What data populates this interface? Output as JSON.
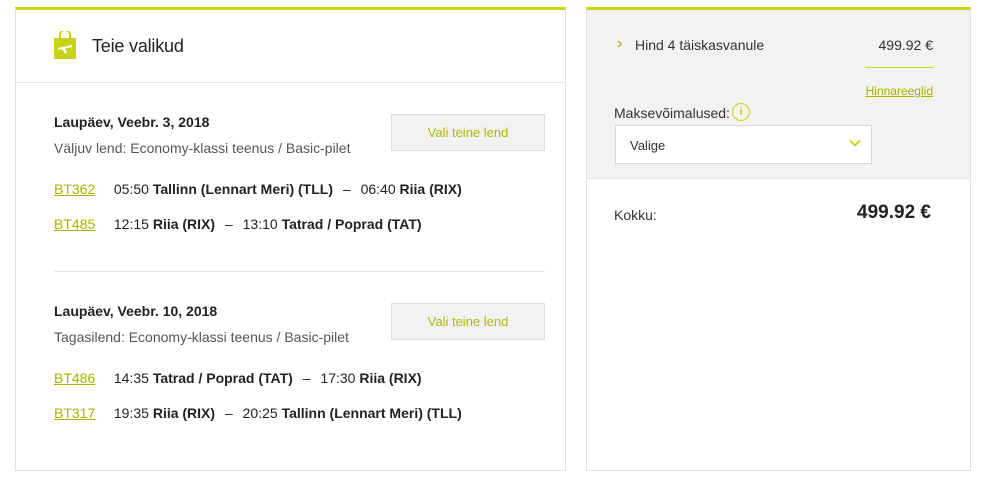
{
  "colors": {
    "accent": "#c8d419",
    "link": "#a9b100"
  },
  "left": {
    "title": "Teie valikud",
    "icon": "shopping-bag-plane-icon",
    "outbound": {
      "date": "Laupäev, Veebr. 3, 2018",
      "description": "Väljuv lend: Economy-klassi teenus / Basic-pilet",
      "button": "Vali teine lend",
      "flights": [
        {
          "number": "BT362",
          "dep_time": "05:50",
          "dep_place": "Tallinn (Lennart Meri) (TLL)",
          "arr_time": "06:40",
          "arr_place": "Riia (RIX)"
        },
        {
          "number": "BT485",
          "dep_time": "12:15",
          "dep_place": "Riia (RIX)",
          "arr_time": "13:10",
          "arr_place": "Tatrad / Poprad (TAT)"
        }
      ]
    },
    "return": {
      "date": "Laupäev, Veebr. 10, 2018",
      "description": "Tagasilend: Economy-klassi teenus / Basic-pilet",
      "button": "Vali teine lend",
      "flights": [
        {
          "number": "BT486",
          "dep_time": "14:35",
          "dep_place": "Tatrad / Poprad (TAT)",
          "arr_time": "17:30",
          "arr_place": "Riia (RIX)"
        },
        {
          "number": "BT317",
          "dep_time": "19:35",
          "dep_place": "Riia (RIX)",
          "arr_time": "20:25",
          "arr_place": "Tallinn (Lennart Meri) (TLL)"
        }
      ]
    }
  },
  "right": {
    "price_label": "Hind 4 täiskasvanule",
    "price_value": "499.92 €",
    "rules_link": "Hinnareeglid",
    "payment_label": "Maksevõimalused:",
    "info_icon": "i",
    "select_value": "Valige",
    "total_label": "Kokku:",
    "total_value": "499.92 €"
  }
}
